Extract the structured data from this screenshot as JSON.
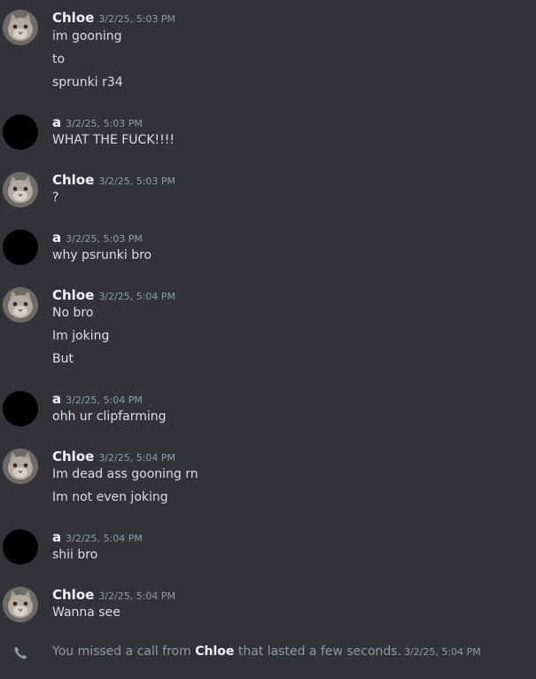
{
  "messages": [
    {
      "author": "Chloe",
      "time": "3/2/25, 5:03 PM",
      "avatar": "cat-avatar",
      "lines": [
        "im gooning",
        "to",
        "sprunki r34"
      ]
    },
    {
      "author": "a",
      "time": "3/2/25, 5:03 PM",
      "avatar": "black-avatar",
      "lines": [
        "WHAT THE FUCK!!!!"
      ]
    },
    {
      "author": "Chloe",
      "time": "3/2/25, 5:03 PM",
      "avatar": "cat-avatar",
      "lines": [
        "?"
      ]
    },
    {
      "author": "a",
      "time": "3/2/25, 5:03 PM",
      "avatar": "black-avatar",
      "lines": [
        "why psrunki bro"
      ]
    },
    {
      "author": "Chloe",
      "time": "3/2/25, 5:04 PM",
      "avatar": "cat-avatar",
      "lines": [
        "No bro",
        "Im joking",
        "But"
      ]
    },
    {
      "author": "a",
      "time": "3/2/25, 5:04 PM",
      "avatar": "black-avatar",
      "lines": [
        "ohh ur clipfarming"
      ]
    },
    {
      "author": "Chloe",
      "time": "3/2/25, 5:04 PM",
      "avatar": "cat-avatar",
      "lines": [
        "Im dead ass gooning rn",
        "Im not even joking"
      ]
    },
    {
      "author": "a",
      "time": "3/2/25, 5:04 PM",
      "avatar": "black-avatar",
      "lines": [
        "shii bro"
      ]
    },
    {
      "author": "Chloe",
      "time": "3/2/25, 5:04 PM",
      "avatar": "cat-avatar",
      "lines": [
        "Wanna see"
      ]
    }
  ],
  "missed_call": {
    "prefix": "You missed a call from ",
    "name": "Chloe",
    "suffix": " that lasted a few seconds.",
    "time": "3/2/25, 5:04 PM",
    "icon": "phone-icon"
  },
  "colors": {
    "background": "#313338",
    "author": "#f2f3f5",
    "message_text": "#dbdee1",
    "timestamp": "#949ba4"
  }
}
